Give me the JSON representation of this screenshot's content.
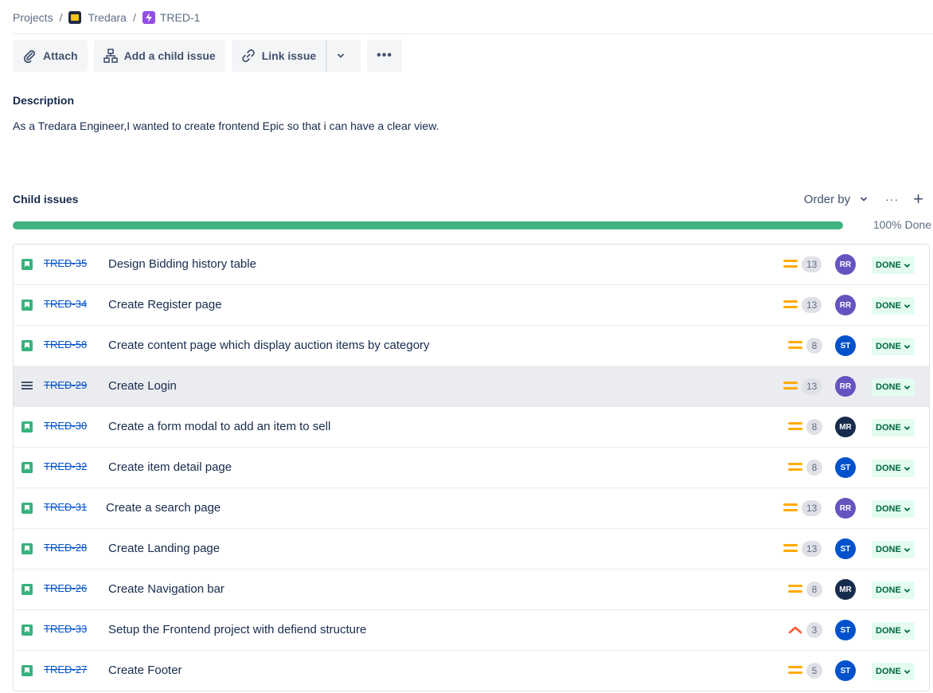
{
  "breadcrumb": {
    "projects": "Projects",
    "project": "Tredara",
    "issue": "TRED-1"
  },
  "toolbar": {
    "attach": "Attach",
    "add_child": "Add a child issue",
    "link_issue": "Link issue"
  },
  "description": {
    "title": "Description",
    "text": "As a Tredara Engineer,I wanted to create frontend Epic so that i can have a clear view."
  },
  "child_issues": {
    "title": "Child issues",
    "order_by": "Order by",
    "progress_label": "100% Done",
    "progress_value": 100,
    "items": [
      {
        "key": "TRED-35",
        "summary": "Design Bidding history table",
        "type": "story",
        "priority": "medium",
        "points": "13",
        "assignee": "RR",
        "status": "DONE"
      },
      {
        "key": "TRED-34",
        "summary": "Create Register page",
        "type": "story",
        "priority": "medium",
        "points": "13",
        "assignee": "RR",
        "status": "DONE"
      },
      {
        "key": "TRED-58",
        "summary": "Create content page which display auction items by category",
        "type": "story",
        "priority": "medium",
        "points": "8",
        "assignee": "ST",
        "status": "DONE"
      },
      {
        "key": "TRED-29",
        "summary": "Create Login",
        "type": "task",
        "priority": "medium",
        "points": "13",
        "assignee": "RR",
        "status": "DONE"
      },
      {
        "key": "TRED-30",
        "summary": "Create a form modal to add an item to sell",
        "type": "story",
        "priority": "medium",
        "points": "8",
        "assignee": "MR",
        "status": "DONE"
      },
      {
        "key": "TRED-32",
        "summary": "Create item detail page",
        "type": "story",
        "priority": "medium",
        "points": "8",
        "assignee": "ST",
        "status": "DONE"
      },
      {
        "key": "TRED-31",
        "summary": "Create a search page",
        "type": "story",
        "priority": "medium",
        "points": "13",
        "assignee": "RR",
        "status": "DONE"
      },
      {
        "key": "TRED-28",
        "summary": "Create Landing page",
        "type": "story",
        "priority": "medium",
        "points": "13",
        "assignee": "ST",
        "status": "DONE"
      },
      {
        "key": "TRED-26",
        "summary": "Create Navigation bar",
        "type": "story",
        "priority": "medium",
        "points": "8",
        "assignee": "MR",
        "status": "DONE"
      },
      {
        "key": "TRED-33",
        "summary": "Setup the Frontend project with defiend structure",
        "type": "story",
        "priority": "high",
        "points": "3",
        "assignee": "ST",
        "status": "DONE"
      },
      {
        "key": "TRED-27",
        "summary": "Create Footer",
        "type": "story",
        "priority": "medium",
        "points": "5",
        "assignee": "ST",
        "status": "DONE"
      }
    ]
  },
  "colors": {
    "progress": "#3fb27f",
    "story": "#36b37e",
    "priority_medium": "#ffab00",
    "priority_high": "#ff5630",
    "avatar_RR": "#6554c0",
    "avatar_ST": "#0052cc",
    "avatar_MR": "#172b4d",
    "done_bg": "#e3fcef",
    "done_text": "#006644"
  }
}
